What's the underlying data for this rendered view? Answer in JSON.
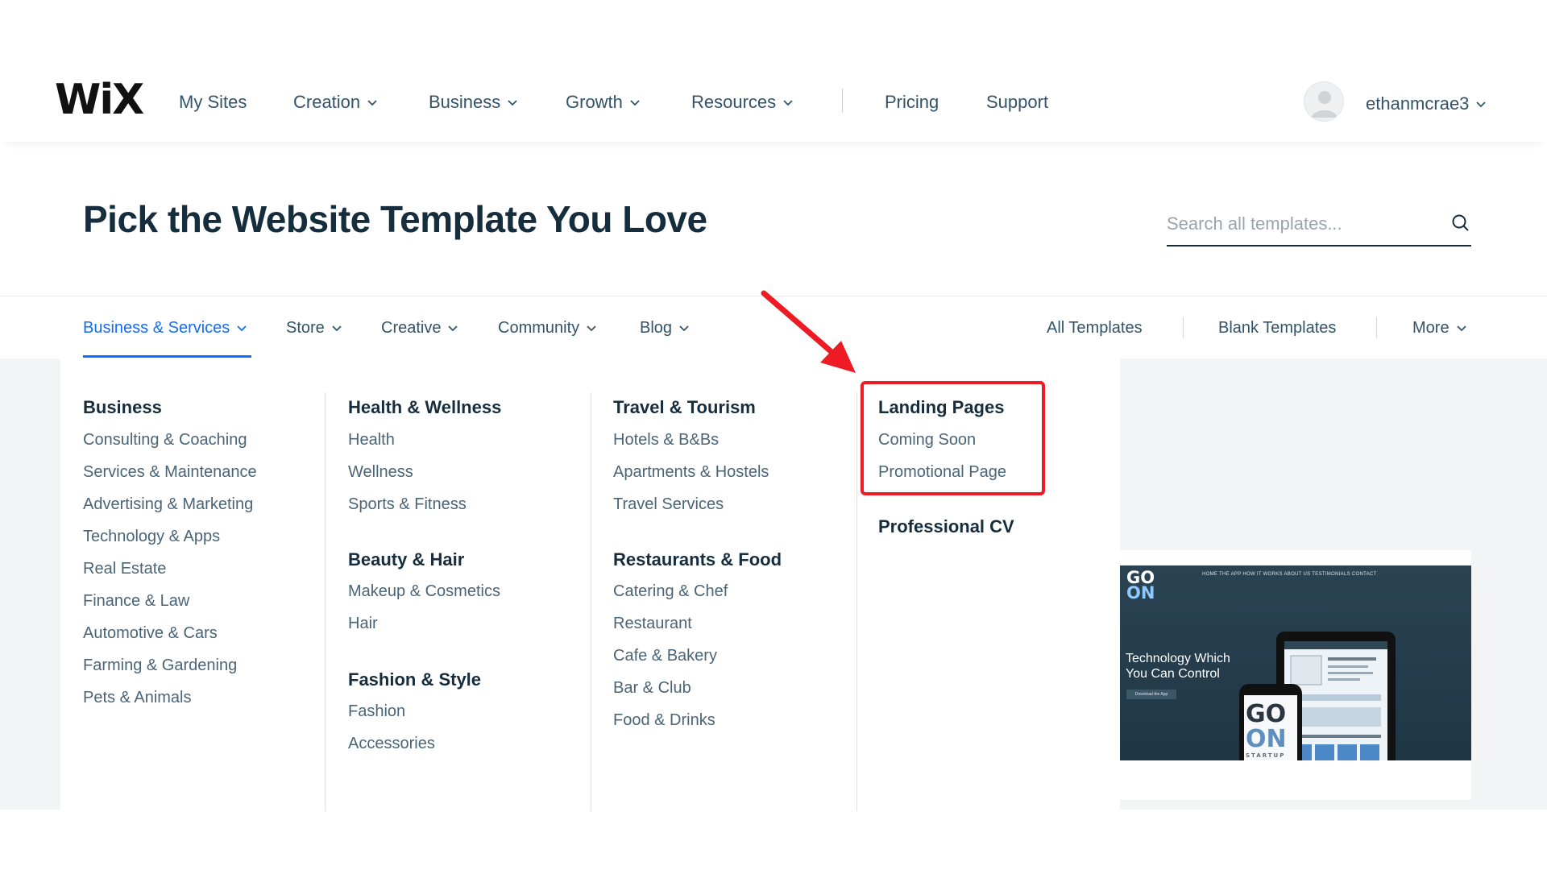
{
  "logo": "WiX",
  "nav": {
    "my_sites": "My Sites",
    "creation": "Creation",
    "business": "Business",
    "growth": "Growth",
    "resources": "Resources",
    "pricing": "Pricing",
    "support": "Support",
    "username": "ethanmcrae3"
  },
  "header": {
    "title": "Pick the Website Template You Love",
    "search_placeholder": "Search all templates..."
  },
  "categories": {
    "business_services": "Business & Services",
    "store": "Store",
    "creative": "Creative",
    "community": "Community",
    "blog": "Blog",
    "all_templates": "All Templates",
    "blank_templates": "Blank Templates",
    "more": "More"
  },
  "menu": {
    "business": {
      "title": "Business",
      "items": [
        "Consulting & Coaching",
        "Services & Maintenance",
        "Advertising & Marketing",
        "Technology & Apps",
        "Real Estate",
        "Finance & Law",
        "Automotive & Cars",
        "Farming & Gardening",
        "Pets & Animals"
      ]
    },
    "health": {
      "title": "Health & Wellness",
      "items": [
        "Health",
        "Wellness",
        "Sports & Fitness"
      ]
    },
    "beauty": {
      "title": "Beauty & Hair",
      "items": [
        "Makeup & Cosmetics",
        "Hair"
      ]
    },
    "fashion": {
      "title": "Fashion & Style",
      "items": [
        "Fashion",
        "Accessories"
      ]
    },
    "travel": {
      "title": "Travel & Tourism",
      "items": [
        "Hotels & B&Bs",
        "Apartments & Hostels",
        "Travel Services"
      ]
    },
    "restaurants": {
      "title": "Restaurants & Food",
      "items": [
        "Catering & Chef",
        "Restaurant",
        "Cafe & Bakery",
        "Bar & Club",
        "Food & Drinks"
      ]
    },
    "landing": {
      "title": "Landing Pages",
      "items": [
        "Coming Soon",
        "Promotional Page"
      ]
    },
    "cv": {
      "title": "Professional CV"
    }
  },
  "preview": {
    "logo_top": "GO",
    "logo_bottom": "ON",
    "nav_text": "HOME   THE APP   HOW IT WORKS   ABOUT US   TESTIMONIALS   CONTACT",
    "headline_line1": "Technology Which",
    "headline_line2": "You Can Control",
    "button": "Download the App",
    "phone_logo_top": "GO",
    "phone_logo_bottom": "ON",
    "phone_logo_sub": "STARTUP"
  },
  "colors": {
    "accent": "#116dff",
    "highlight": "#ee1a24",
    "text_dark": "#162d3d",
    "text_link": "#4a6478"
  }
}
